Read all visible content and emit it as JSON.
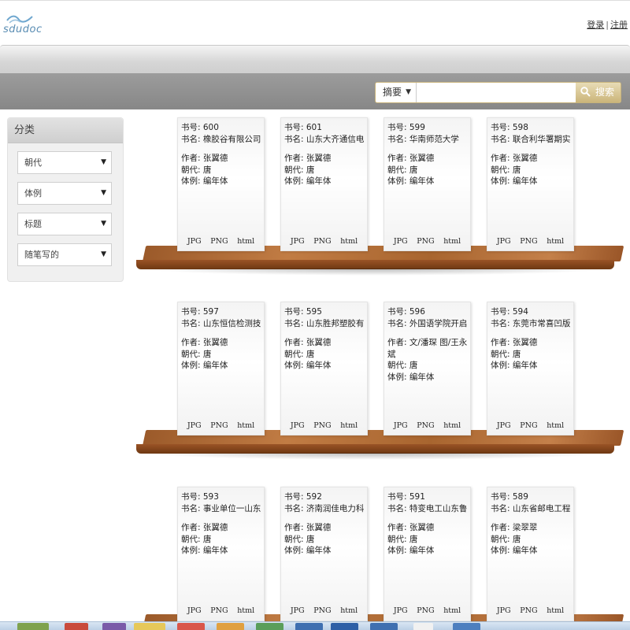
{
  "header": {
    "logo_text": "sdudoc",
    "login": "登录",
    "separator": "|",
    "register": "注册"
  },
  "search": {
    "scope": "摘要",
    "button": "搜索",
    "placeholder": ""
  },
  "sidebar": {
    "title": "分类",
    "filters": [
      "朝代",
      "体例",
      "标题",
      "随笔写的"
    ]
  },
  "books": [
    {
      "id_label": "书号: 600",
      "name_label": "书名: 橡胶谷有限公司",
      "author": "作者: 张翼德",
      "dynasty": "朝代: 唐",
      "style": "体例: 编年体"
    },
    {
      "id_label": "书号: 601",
      "name_label": "书名: 山东大齐通信电",
      "author": "作者: 张翼德",
      "dynasty": "朝代: 唐",
      "style": "体例: 编年体"
    },
    {
      "id_label": "书号: 599",
      "name_label": "书名: 华南师范大学",
      "author": "作者: 张翼德",
      "dynasty": "朝代: 唐",
      "style": "体例: 编年体"
    },
    {
      "id_label": "书号: 598",
      "name_label": "书名: 联合利华署期实",
      "author": "作者: 张翼德",
      "dynasty": "朝代: 唐",
      "style": "体例: 编年体"
    },
    {
      "id_label": "书号: 597",
      "name_label": "书名: 山东恒信检测技",
      "author": "作者: 张翼德",
      "dynasty": "朝代: 唐",
      "style": "体例: 编年体"
    },
    {
      "id_label": "书号: 595",
      "name_label": "书名: 山东胜邦塑胶有",
      "author": "作者: 张翼德",
      "dynasty": "朝代: 唐",
      "style": "体例: 编年体"
    },
    {
      "id_label": "书号: 596",
      "name_label": "书名: 外国语学院开启",
      "author": "作者: 文/潘琛 图/王永斌",
      "dynasty": "朝代: 唐",
      "style": "体例: 编年体"
    },
    {
      "id_label": "书号: 594",
      "name_label": "书名: 东莞市常喜凹版",
      "author": "作者: 张翼德",
      "dynasty": "朝代: 唐",
      "style": "体例: 编年体"
    },
    {
      "id_label": "书号: 593",
      "name_label": "书名: 事业单位一山东",
      "author": "作者: 张翼德",
      "dynasty": "朝代: 唐",
      "style": "体例: 编年体"
    },
    {
      "id_label": "书号: 592",
      "name_label": "书名: 济南润佳电力科",
      "author": "作者: 张翼德",
      "dynasty": "朝代: 唐",
      "style": "体例: 编年体"
    },
    {
      "id_label": "书号: 591",
      "name_label": "书名: 特变电工山东鲁",
      "author": "作者: 张翼德",
      "dynasty": "朝代: 唐",
      "style": "体例: 编年体"
    },
    {
      "id_label": "书号: 589",
      "name_label": "书名: 山东省邮电工程",
      "author": "作者: 梁翠翠",
      "dynasty": "朝代: 唐",
      "style": "体例: 编年体"
    }
  ],
  "link_labels": {
    "jpg": "JPG",
    "png": "PNG",
    "html": "html"
  },
  "colors": {
    "accent": "#c7b27a",
    "wood": "#a8652f",
    "band": "#8f8f8f"
  }
}
